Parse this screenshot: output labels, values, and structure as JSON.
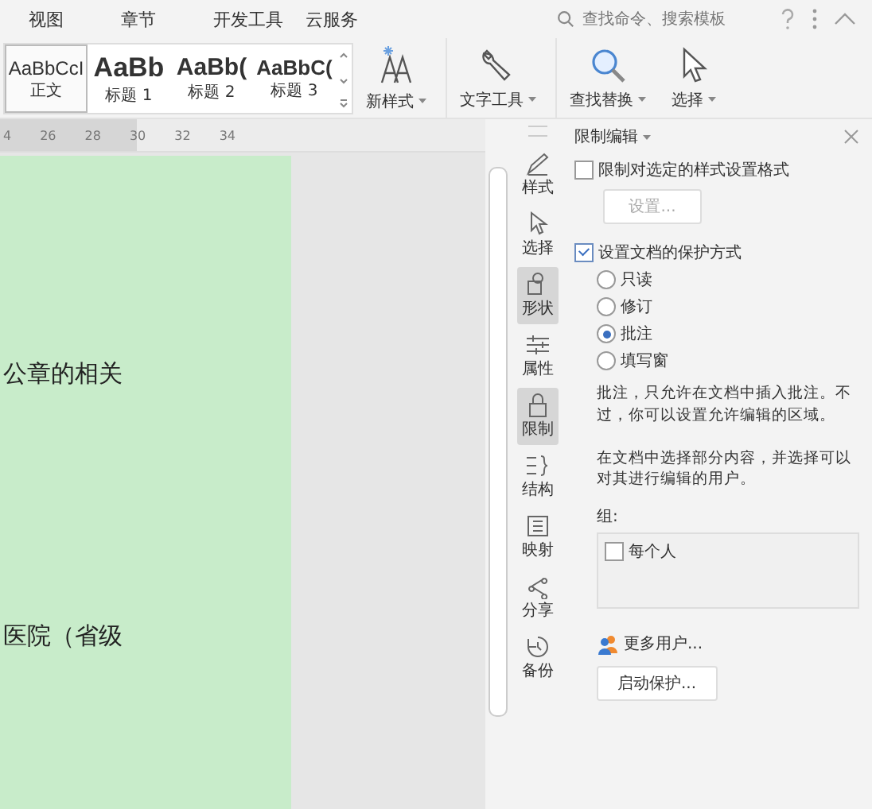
{
  "menu_tabs": [
    "视图",
    "章节",
    "开发工具",
    "云服务"
  ],
  "search": {
    "placeholder": "查找命令、搜索模板"
  },
  "style_gallery": [
    {
      "preview": "AaBbCcI",
      "label": "正文",
      "selected": true,
      "kind": "normal"
    },
    {
      "preview": "AaBb",
      "label": "标题 1",
      "selected": false,
      "kind": "h1"
    },
    {
      "preview": "AaBb(",
      "label": "标题 2",
      "selected": false,
      "kind": "h2"
    },
    {
      "preview": "AaBbC(",
      "label": "标题 3",
      "selected": false,
      "kind": "h3"
    }
  ],
  "ribbon_tools": [
    {
      "label": "新样式",
      "kind": "newstyle"
    },
    {
      "label": "文字工具",
      "kind": "wrench"
    },
    {
      "label": "查找替换",
      "kind": "search"
    },
    {
      "label": "选择",
      "kind": "pointer"
    }
  ],
  "ruler": [
    "4",
    "26",
    "28",
    "30",
    "32",
    "34"
  ],
  "document_lines": [
    "公章的相关",
    "医院（省级"
  ],
  "side_tools": [
    {
      "label": "样式",
      "kind": "pen",
      "selected": false
    },
    {
      "label": "选择",
      "kind": "pointer",
      "selected": false
    },
    {
      "label": "形状",
      "kind": "shapes",
      "selected": true
    },
    {
      "label": "属性",
      "kind": "sliders",
      "selected": false
    },
    {
      "label": "限制",
      "kind": "lock",
      "selected": true
    },
    {
      "label": "结构",
      "kind": "structure",
      "selected": false
    },
    {
      "label": "映射",
      "kind": "map",
      "selected": false
    },
    {
      "label": "分享",
      "kind": "share",
      "selected": false
    },
    {
      "label": "备份",
      "kind": "clock",
      "selected": false
    }
  ],
  "panel": {
    "title": "限制编辑",
    "format_limit": {
      "label": "限制对选定的样式设置格式",
      "checked": false
    },
    "settings_button": {
      "label": "设置...",
      "disabled": true
    },
    "protect": {
      "label": "设置文档的保护方式",
      "checked": true
    },
    "modes": [
      {
        "label": "只读",
        "selected": false
      },
      {
        "label": "修订",
        "selected": false
      },
      {
        "label": "批注",
        "selected": true
      },
      {
        "label": "填写窗",
        "selected": false
      }
    ],
    "description": "批注，只允许在文档中插入批注。不过，你可以设置允许编辑的区域。",
    "hint": "在文档中选择部分内容，并选择可以对其进行编辑的用户。",
    "group_label": "组:",
    "groups": [
      {
        "label": "每个人",
        "checked": false
      }
    ],
    "more_users": "更多用户...",
    "start_button": "启动保护..."
  }
}
